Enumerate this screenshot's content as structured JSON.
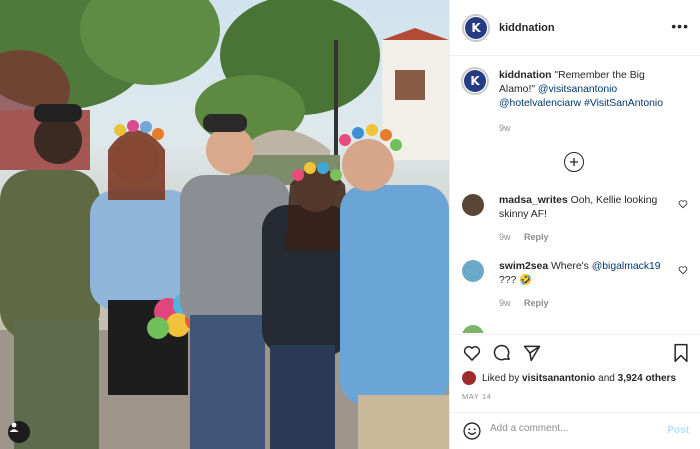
{
  "post": {
    "author": "kiddnation",
    "avatar_letter": "K",
    "caption_text": "\"Remember the Big Alamo!\"",
    "caption_tags": [
      "@visitsanantonio",
      "@hotelvalenciarw",
      "#VisitSanAntonio"
    ],
    "caption_age": "9w",
    "more_label": "•••"
  },
  "comments": [
    {
      "user": "madsa_writes",
      "text": "Ooh, Kellie looking skinny AF!",
      "age": "9w",
      "reply_label": "Reply",
      "avatar_color": "#5a4634"
    },
    {
      "user": "swim2sea",
      "text": "Where's",
      "mention": "@bigalmack19",
      "suffix": "??? 🤣",
      "age": "9w",
      "reply_label": "Reply",
      "avatar_color": "#6aa9c8"
    }
  ],
  "engagement": {
    "liked_prefix": "Liked by",
    "liked_by": "visitsanantonio",
    "liked_and": "and",
    "liked_count": "3,924 others",
    "date": "MAY 14"
  },
  "add_comment": {
    "placeholder": "Add a comment...",
    "post_label": "Post"
  },
  "icons": [
    "heart-icon",
    "comment-icon",
    "share-icon",
    "bookmark-icon",
    "smile-icon",
    "plus-circle-icon",
    "user-tag-icon"
  ],
  "colors": {
    "link": "#00376b",
    "muted": "#8e8e8e",
    "brand": "#253b84",
    "post_disabled": "#b2dffc"
  }
}
